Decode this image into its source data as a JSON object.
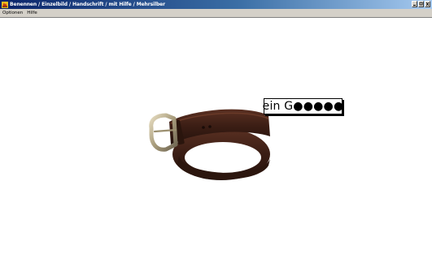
{
  "window": {
    "title": "Benennen / Einzelbild / Handschrift / mit Hilfe / Mehrsilber",
    "app_icon": "app-icon",
    "buttons": [
      "minimize-icon",
      "maximize-icon",
      "close-icon"
    ]
  },
  "menu": {
    "items": [
      {
        "label": "Optionen"
      },
      {
        "label": "Hilfe"
      }
    ]
  },
  "main": {
    "image_subject": "belt",
    "answer_hint": "ein G●●●●●"
  },
  "colors": {
    "titlebar_start": "#0a246a",
    "titlebar_end": "#a6caf0",
    "menubar_bg": "#d4d0c8",
    "belt_leather": "#3b1e14",
    "buckle_metal": "#b9ad8e"
  }
}
